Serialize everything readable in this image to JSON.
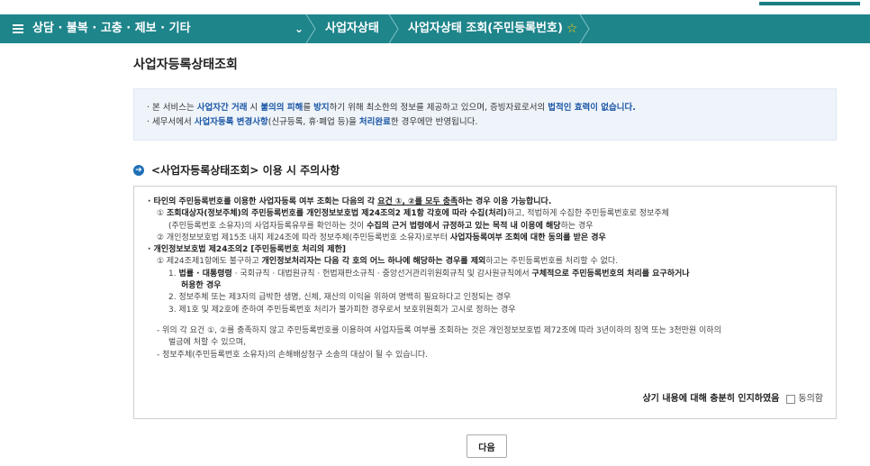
{
  "nav": {
    "menu_label": "상담 · 불복 · 고충 · 제보 · 기타",
    "chevron": "⌄",
    "crumb1": "사업자상태",
    "crumb2": "사업자상태 조회(주민등록번호)",
    "star": "☆",
    "color": "#1e858b"
  },
  "page_title": "사업자등록상태조회",
  "notice": {
    "line1": [
      "· 본 서비스는 ",
      "사업자간 거래",
      " 시 ",
      "불의의 피해",
      "를 ",
      "방지",
      "하기 위해 최소한의 정보를 제공하고 있으며, 증빙자료로서의 ",
      "법적인 효력이 없습니다."
    ],
    "line2": [
      "· 세무서에서 ",
      "사업자등록 변경사항",
      "(신규등록, 휴·폐업 등)을 ",
      "처리완료",
      "한 경우에만 반영됩니다."
    ]
  },
  "section": {
    "icon": "➔",
    "title": "<사업자등록상태조회> 이용 시 주의사항"
  },
  "caution": {
    "l1": [
      "· 타인의 주민등록번호를 이용한 사업자등록 여부 조회는 다음의 각 ",
      "요건 ①, ②를 모두 충족",
      "하는 경우 이용 가능합니다."
    ],
    "l2a": [
      "① ",
      "조회대상자(정보주체)의 주민등록번호를 개인정보보호법 제24조의2 제1항 각호에 따라 수집(처리)",
      "하고, 적법하게 수집한 주민등록번호로 정보주체"
    ],
    "l2b": [
      "(주민등록번호 소유자)의 사업자등록유무를 확인하는 것이 ",
      "수집의 근거 법령에서 규정하고 있는 목적 내 이용에 해당",
      "하는 경우"
    ],
    "l3": [
      "② 개인정보보호법 제15조 내지 제24조에 따라 정보주체(주민등록번호 소유자)로부터 ",
      "사업자등록여부 조회에 대한 동의를 받은 경우"
    ],
    "l4": "· 개인정보보호법 제24조의2 [주민등록번호 처리의 제한]",
    "l5": [
      "① 제24조제1항에도 불구하고 ",
      "개인정보처리자는 다음 각 호의 어느 하나에 해당하는 경우를 제외",
      "하고는 주민등록번호를 처리할 수 없다."
    ],
    "l6a": [
      "1. ",
      "법률 · 대통령령",
      " · 국회규칙 · 대법원규칙 · 헌법재판소규칙 · 중앙선거관리위원회규칙 및 감사원규칙에서 ",
      "구체적으로 주민등록번호의 처리를 요구하거나"
    ],
    "l6b": "허용한 경우",
    "l7": "2. 정보주체 또는 제3자의 급박한 생명, 신체, 재산의 이익을 위하여 명백히 필요하다고 인정되는 경우",
    "l8": "3. 제1호 및 제2호에 준하여 주민등록번호 처리가 불가피한 경우로서 보호위원회가 고시로 정하는 경우",
    "l9a": "- 위의 각 요건 ①, ②를 충족하지 않고 주민등록번호를 이용하여 사업자등록 여부를 조회하는 것은 개인정보보호법 제72조에 따라 3년이하의 징역 또는 3천만원 이하의",
    "l9b": "벌금에 처할 수 있으며,",
    "l10": "- 정보주체(주민등록번호 소유자)의 손해배상청구 소송의 대상이 될 수 있습니다."
  },
  "agree": {
    "statement": "상기 내용에 대해 충분히 인지하였음",
    "checkbox_label": "동의함"
  },
  "next_button": "다음"
}
